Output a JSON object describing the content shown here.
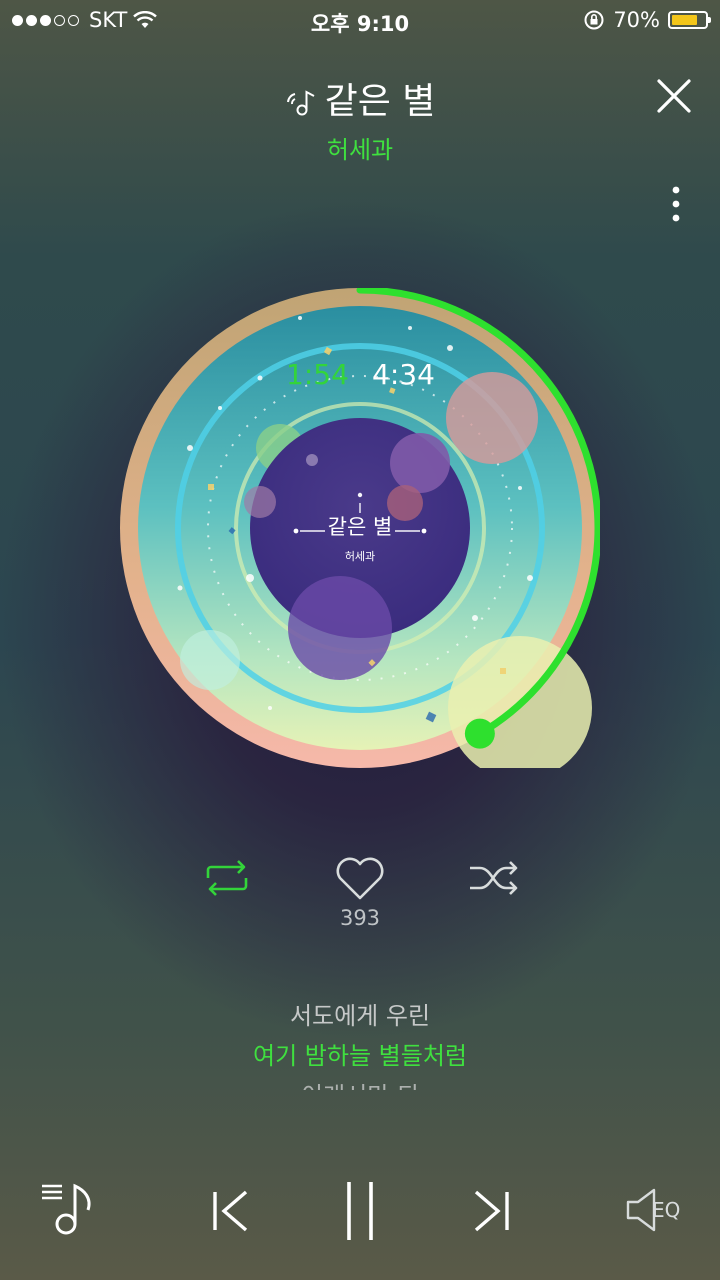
{
  "status": {
    "carrier": "SKT",
    "time": "오후 9:10",
    "battery": "70%",
    "battery_level": 0.7,
    "signal_bars_filled": 3,
    "signal_bars_total": 5
  },
  "header": {
    "title": "같은 별",
    "artist": "허세과"
  },
  "player": {
    "elapsed": "1:54",
    "duration": "4:34",
    "progress": 0.416,
    "album_title": "같은 별",
    "album_artist": "허세과",
    "like_count": "393"
  },
  "lyrics": {
    "previous": "서도에게 우린",
    "current": "여기 밤하늘 별들처럼",
    "next": "이래서만 되"
  },
  "controls": {
    "eq_label": "EQ"
  },
  "colors": {
    "accent": "#3fe03f",
    "progress": "#2ee02e"
  },
  "icons": [
    "music-note-icon",
    "close-icon",
    "more-vertical-icon",
    "repeat-icon",
    "heart-icon",
    "shuffle-icon",
    "playlist-icon",
    "previous-icon",
    "pause-icon",
    "next-icon",
    "eq-speaker-icon"
  ]
}
